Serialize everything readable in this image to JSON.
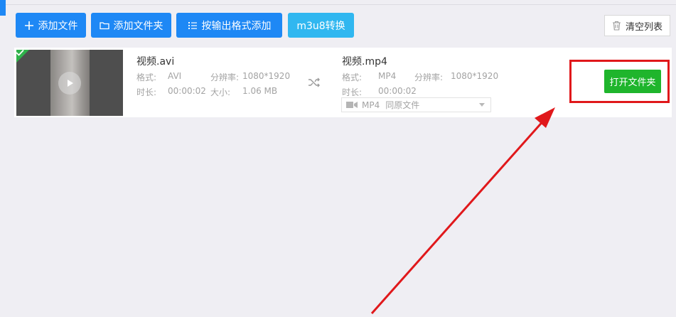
{
  "toolbar": {
    "add_file_label": "添加文件",
    "add_folder_label": "添加文件夹",
    "add_by_format_label": "按输出格式添加",
    "m3u8_label": "m3u8转换",
    "clear_list_label": "清空列表"
  },
  "file_row": {
    "status": "completed",
    "source": {
      "name": "视频.avi",
      "format_label": "格式:",
      "format_value": "AVI",
      "resolution_label": "分辨率:",
      "resolution_value": "1080*1920",
      "duration_label": "时长:",
      "duration_value": "00:00:02",
      "size_label": "大小:",
      "size_value": "1.06 MB"
    },
    "output": {
      "name": "视频.mp4",
      "format_label": "格式:",
      "format_value": "MP4",
      "resolution_label": "分辨率:",
      "resolution_value": "1080*1920",
      "duration_label": "时长:",
      "duration_value": "00:00:02",
      "selected_format": "MP4",
      "selected_quality": "同原文件"
    },
    "open_folder_label": "打开文件夹"
  },
  "colors": {
    "primary": "#1e88f5",
    "primary_light": "#30b7f0",
    "success": "#1fb52c",
    "highlight": "#e0181b",
    "background": "#efeef3"
  }
}
